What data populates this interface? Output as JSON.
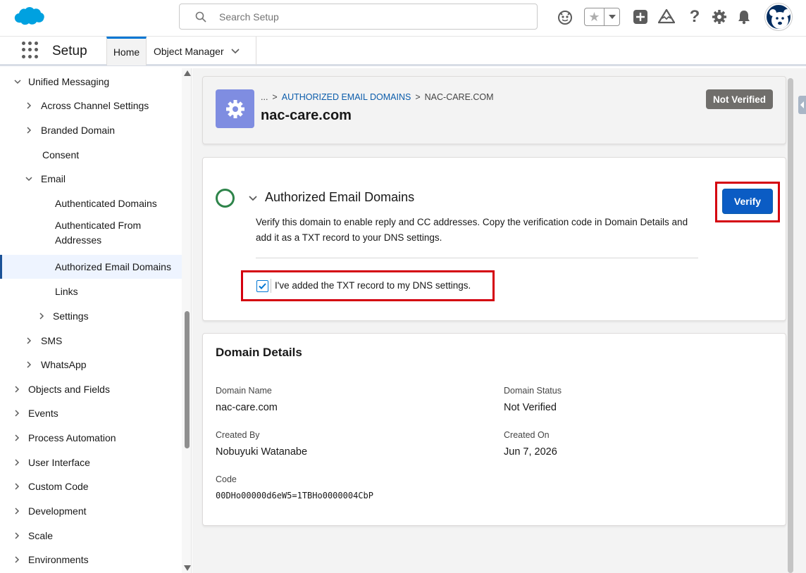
{
  "header": {
    "search_placeholder": "Search Setup",
    "icons": [
      "astro-icon",
      "favorites-star-icon",
      "chevron-down-icon",
      "add-icon",
      "trailhead-icon",
      "help-icon",
      "gear-icon",
      "bell-icon",
      "avatar"
    ]
  },
  "nav": {
    "app_name": "Setup",
    "tabs": [
      {
        "label": "Home"
      },
      {
        "label": "Object Manager"
      }
    ]
  },
  "sidebar": {
    "items": [
      {
        "label": "Unified Messaging"
      },
      {
        "label": "Across Channel Settings"
      },
      {
        "label": "Branded Domain"
      },
      {
        "label": "Consent"
      },
      {
        "label": "Email"
      },
      {
        "label": "Authenticated Domains"
      },
      {
        "label": "Authenticated From"
      },
      {
        "label": "Addresses"
      },
      {
        "label": "Authorized Email Domains"
      },
      {
        "label": "Links"
      },
      {
        "label": "Settings"
      },
      {
        "label": "SMS"
      },
      {
        "label": "WhatsApp"
      },
      {
        "label": "Objects and Fields"
      },
      {
        "label": "Events"
      },
      {
        "label": "Process Automation"
      },
      {
        "label": "User Interface"
      },
      {
        "label": "Custom Code"
      },
      {
        "label": "Development"
      },
      {
        "label": "Scale"
      },
      {
        "label": "Environments"
      }
    ]
  },
  "record": {
    "breadcrumb": [
      "...",
      ">",
      "AUTHORIZED EMAIL DOMAINS",
      ">",
      "NAC-CARE.COM"
    ],
    "title": "nac-care.com",
    "status": "Not Verified"
  },
  "verify_section": {
    "title": "Authorized Email Domains",
    "description": "Verify this domain to enable reply and CC addresses. Copy the verification code in Domain Details and add it as a TXT record to your DNS settings.",
    "checkbox_label": "I've added the TXT record to my DNS settings.",
    "checkbox_checked": true,
    "verify_button": "Verify"
  },
  "details": {
    "title": "Domain Details",
    "domain_name_label": "Domain Name",
    "domain_name": "nac-care.com",
    "domain_status_label": "Domain Status",
    "domain_status": "Not Verified",
    "created_by_label": "Created By",
    "created_by": "Nobuyuki Watanabe",
    "created_on_label": "Created On",
    "created_on": "Jun 7, 2026",
    "code_label": "Code",
    "code": "00DHo00000d6eW5=1TBHo0000004CbP"
  },
  "colors": {
    "brand_blue": "#0b5cc4",
    "highlight_red": "#d4000f",
    "status_gray": "#706e6b",
    "success_green": "#2e844a"
  }
}
